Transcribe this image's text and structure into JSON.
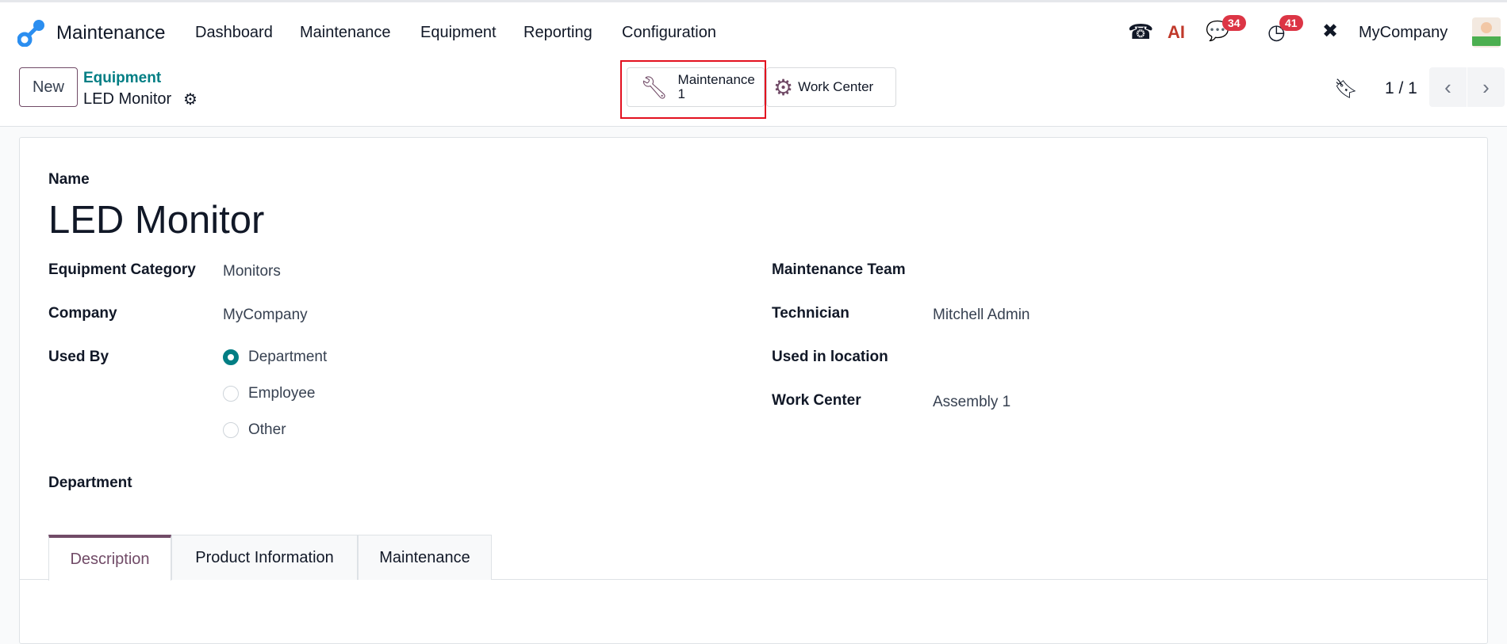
{
  "navbar": {
    "app_name": "Maintenance",
    "menu": [
      "Dashboard",
      "Maintenance",
      "Equipment",
      "Reporting",
      "Configuration"
    ],
    "messages_count": "34",
    "activities_count": "41",
    "ai_label": "AI",
    "company": "MyCompany"
  },
  "control_panel": {
    "new_label": "New",
    "breadcrumb_parent": "Equipment",
    "breadcrumb_current": "LED Monitor",
    "smart_buttons": {
      "maintenance_label": "Maintenance",
      "maintenance_count": "1",
      "work_center_label": "Work Center"
    },
    "pager": "1 / 1"
  },
  "form": {
    "name_label": "Name",
    "name": "LED Monitor",
    "left": {
      "category_label": "Equipment Category",
      "category": "Monitors",
      "company_label": "Company",
      "company": "MyCompany",
      "used_by_label": "Used By",
      "used_by_options": [
        "Department",
        "Employee",
        "Other"
      ],
      "used_by_selected": "Department",
      "department_label": "Department"
    },
    "right": {
      "team_label": "Maintenance Team",
      "technician_label": "Technician",
      "technician": "Mitchell Admin",
      "location_label": "Used in location",
      "work_center_label": "Work Center",
      "work_center": "Assembly 1"
    },
    "tabs": [
      "Description",
      "Product Information",
      "Maintenance"
    ],
    "active_tab": "Description"
  },
  "colors": {
    "accent": "#714b67",
    "teal": "#017e84",
    "highlight": "#e3101f",
    "badge": "#dc3545"
  }
}
